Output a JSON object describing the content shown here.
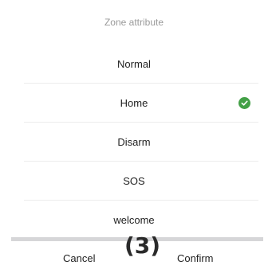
{
  "sheet": {
    "title": "Zone attribute",
    "options": [
      {
        "label": "Normal",
        "selected": false
      },
      {
        "label": "Home",
        "selected": true
      },
      {
        "label": "Disarm",
        "selected": false
      },
      {
        "label": "SOS",
        "selected": false
      },
      {
        "label": "welcome",
        "selected": false
      }
    ],
    "check_icon": "check-circle-icon",
    "check_color": "#43a047"
  },
  "footer": {
    "cancel_label": "Cancel",
    "confirm_label": "Confirm"
  },
  "annotation": {
    "step_label": "(3)"
  }
}
